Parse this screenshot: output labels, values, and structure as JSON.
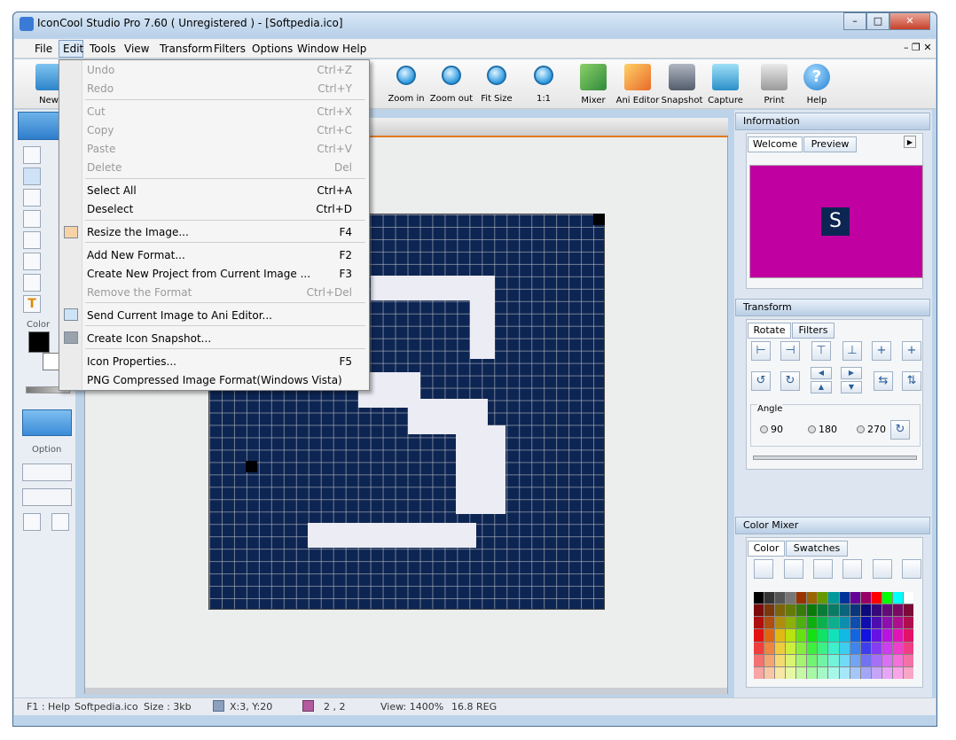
{
  "window": {
    "title": "IconCool Studio Pro 7.60 ( Unregistered ) - [Softpedia.ico]"
  },
  "menubar": [
    "File",
    "Edit",
    "Tools",
    "View",
    "Transform",
    "Filters",
    "Options",
    "Window",
    "Help"
  ],
  "toolbar": {
    "new": "New",
    "zoom_in": "Zoom in",
    "zoom_out": "Zoom out",
    "fit_size": "Fit Size",
    "one_to_one": "1:1",
    "mixer": "Mixer",
    "ani_editor": "Ani Editor",
    "snapshot": "Snapshot",
    "capture": "Capture",
    "print": "Print",
    "help": "Help"
  },
  "edit_menu": [
    {
      "label": "Undo",
      "shortcut": "Ctrl+Z",
      "disabled": true
    },
    {
      "label": "Redo",
      "shortcut": "Ctrl+Y",
      "disabled": true
    },
    {
      "label": "Cut",
      "shortcut": "Ctrl+X",
      "disabled": true
    },
    {
      "label": "Copy",
      "shortcut": "Ctrl+C",
      "disabled": true
    },
    {
      "label": "Paste",
      "shortcut": "Ctrl+V",
      "disabled": true
    },
    {
      "label": "Delete",
      "shortcut": "Del",
      "disabled": true
    },
    {
      "label": "Select All",
      "shortcut": "Ctrl+A",
      "disabled": false
    },
    {
      "label": "Deselect",
      "shortcut": "Ctrl+D",
      "disabled": false
    },
    {
      "label": "Resize the Image...",
      "shortcut": "F4",
      "disabled": false
    },
    {
      "label": "Add New Format...",
      "shortcut": "F2",
      "disabled": false
    },
    {
      "label": "Create New Project from Current Image ...",
      "shortcut": "F3",
      "disabled": false
    },
    {
      "label": "Remove the Format",
      "shortcut": "Ctrl+Del",
      "disabled": true
    },
    {
      "label": "Send Current Image to Ani Editor...",
      "shortcut": "",
      "disabled": false
    },
    {
      "label": "Create Icon Snapshot...",
      "shortcut": "",
      "disabled": false
    },
    {
      "label": "Icon Properties...",
      "shortcut": "F5",
      "disabled": false
    },
    {
      "label": "PNG Compressed Image Format(Windows Vista)",
      "shortcut": "",
      "disabled": false
    }
  ],
  "left": {
    "color_label": "Color",
    "option_label": "Option"
  },
  "information": {
    "header": "Information",
    "tab_welcome": "Welcome",
    "tab_preview": "Preview",
    "preview_letter": "S"
  },
  "transform": {
    "header": "Transform",
    "tab_rotate": "Rotate",
    "tab_filters": "Filters",
    "angle_label": "Angle",
    "angle_90": "90",
    "angle_180": "180",
    "angle_270": "270"
  },
  "color_mixer": {
    "header": "Color Mixer",
    "tab_color": "Color",
    "tab_swatches": "Swatches"
  },
  "status": {
    "help": "F1 : Help",
    "file": "Softpedia.ico",
    "size": "Size : 3kb",
    "coords": "X:3, Y:20",
    "selection": "2 , 2",
    "view": "View: 1400%",
    "format": "16.8 REG"
  },
  "colors": {
    "preview_bg": "#c000a0",
    "canvas_dark": "#0d2553",
    "accent": "#e07a20"
  }
}
